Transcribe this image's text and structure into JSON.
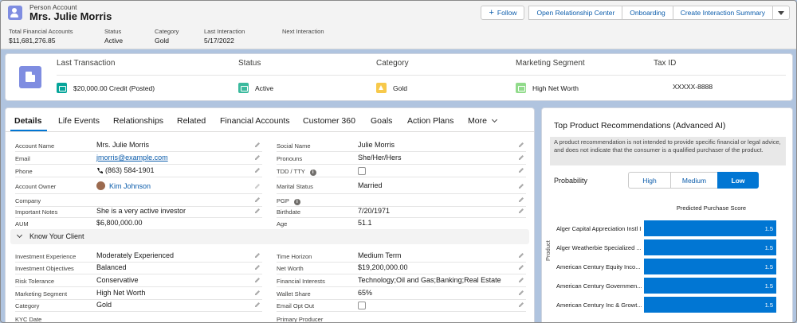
{
  "header": {
    "object_type": "Person Account",
    "name": "Mrs. Julie Morris",
    "buttons": {
      "follow": "Follow",
      "relationship_center": "Open Relationship Center",
      "onboarding": "Onboarding",
      "interaction_summary": "Create Interaction Summary"
    },
    "fields": [
      {
        "label": "Total Financial Accounts",
        "value": "$11,681,276.85"
      },
      {
        "label": "Status",
        "value": "Active"
      },
      {
        "label": "Category",
        "value": "Gold"
      },
      {
        "label": "Last Interaction",
        "value": "5/17/2022"
      },
      {
        "label": "Next Interaction",
        "value": ""
      }
    ]
  },
  "highlights": {
    "columns": [
      {
        "header": "Last Transaction",
        "value": "$20,000.00 Credit (Posted)",
        "icon": "transaction-icon"
      },
      {
        "header": "Status",
        "value": "Active",
        "icon": "status-icon"
      },
      {
        "header": "Category",
        "value": "Gold",
        "icon": "crown-icon"
      },
      {
        "header": "Marketing Segment",
        "value": "High Net Worth",
        "icon": "money-bag-icon"
      },
      {
        "header": "Tax ID",
        "value": "XXXXX-8888",
        "icon": ""
      }
    ]
  },
  "tabs": [
    "Details",
    "Life Events",
    "Relationships",
    "Related",
    "Financial Accounts",
    "Customer 360",
    "Goals",
    "Action Plans",
    "More"
  ],
  "details": {
    "left": [
      {
        "label": "Account Name",
        "value": "Mrs. Julie Morris"
      },
      {
        "label": "Email",
        "value": "jmorris@example.com"
      },
      {
        "label": "Phone",
        "value": "(863) 584-1901"
      },
      {
        "label": "Account Owner",
        "value": "Kim Johnson"
      },
      {
        "label": "Company",
        "value": ""
      },
      {
        "label": "Important Notes",
        "value": "She is a very active investor"
      },
      {
        "label": "AUM",
        "value": "$6,800,000.00"
      }
    ],
    "right": [
      {
        "label": "Social Name",
        "value": "Julie Morris"
      },
      {
        "label": "Pronouns",
        "value": "She/Her/Hers"
      },
      {
        "label": "TDD / TTY",
        "value": ""
      },
      {
        "label": "Marital Status",
        "value": "Married"
      },
      {
        "label": "PGP",
        "value": ""
      },
      {
        "label": "Birthdate",
        "value": "7/20/1971"
      },
      {
        "label": "Age",
        "value": "51.1"
      }
    ],
    "section_title": "Know Your Client",
    "kyc_left": [
      {
        "label": "Investment Experience",
        "value": "Moderately Experienced"
      },
      {
        "label": "Investment Objectives",
        "value": "Balanced"
      },
      {
        "label": "Risk Tolerance",
        "value": "Conservative"
      },
      {
        "label": "Marketing Segment",
        "value": "High Net Worth"
      },
      {
        "label": "Category",
        "value": "Gold"
      },
      {
        "label": "KYC Date",
        "value": ""
      }
    ],
    "kyc_right": [
      {
        "label": "Time Horizon",
        "value": "Medium Term"
      },
      {
        "label": "Net Worth",
        "value": "$19,200,000.00"
      },
      {
        "label": "Financial Interests",
        "value": "Technology;Oil and Gas;Banking;Real Estate"
      },
      {
        "label": "Wallet Share",
        "value": "65%"
      },
      {
        "label": "Email Opt Out",
        "value": ""
      },
      {
        "label": "Primary Producer",
        "value": ""
      }
    ]
  },
  "recommendations": {
    "title": "Top Product Recommendations (Advanced AI)",
    "disclaimer": "A product recommendation is not intended to provide specific financial or legal advice, and does not indicate that the consumer is a qualified purchaser of the product.",
    "probability_label": "Probability",
    "probability_options": [
      "High",
      "Medium",
      "Low"
    ],
    "probability_selected": "Low"
  },
  "chart_data": {
    "type": "bar",
    "orientation": "horizontal",
    "title": "Predicted Purchase Score",
    "xlabel": "",
    "ylabel": "Product",
    "categories": [
      "Alger Capital Appreciation Instl I",
      "Alger Weatherbie Specialized ...",
      "American Century Equity Inco...",
      "American Century Governmen...",
      "American Century Inc & Growt..."
    ],
    "values": [
      1.5,
      1.5,
      1.5,
      1.5,
      1.5
    ],
    "data_labels": [
      "1.5",
      "1.5",
      "1.5",
      "1.5",
      "1.5"
    ],
    "bar_color": "#0176d3"
  },
  "colors": {
    "accent": "#0176d3",
    "link": "#0b5cab",
    "page_background": "#b0c4df",
    "account_icon": "#7f8de1"
  }
}
